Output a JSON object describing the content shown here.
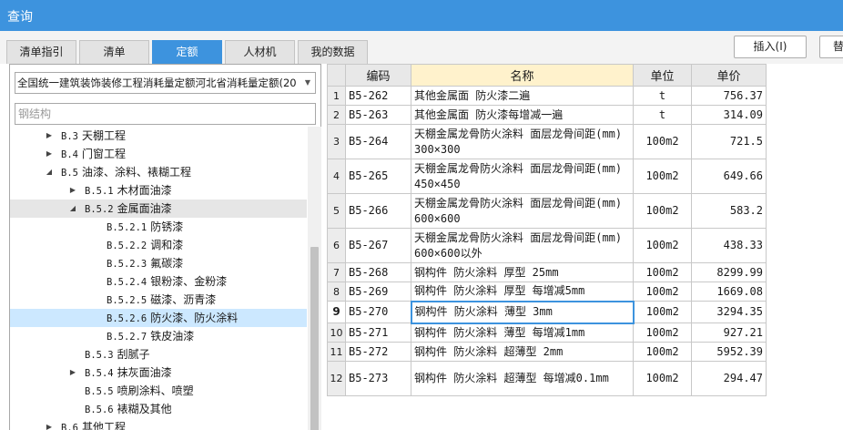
{
  "window": {
    "title": "查询"
  },
  "tabs": [
    "清单指引",
    "清单",
    "定额",
    "人材机",
    "我的数据"
  ],
  "buttons": {
    "insert": "插入(I)",
    "replace": "替"
  },
  "left": {
    "quota_library": "全国统一建筑装饰装修工程消耗量定额河北省消耗量定额(20",
    "search_placeholder": "钢结构",
    "tree": [
      {
        "code": "B.3",
        "label": "天棚工程",
        "level": 1,
        "expander": "collapsed"
      },
      {
        "code": "B.4",
        "label": "门窗工程",
        "level": 1,
        "expander": "collapsed"
      },
      {
        "code": "B.5",
        "label": "油漆、涂料、裱糊工程",
        "level": 1,
        "expander": "expanded"
      },
      {
        "code": "B.5.1",
        "label": "木材面油漆",
        "level": 2,
        "expander": "collapsed"
      },
      {
        "code": "B.5.2",
        "label": "金属面油漆",
        "level": 2,
        "expander": "expanded"
      },
      {
        "code": "B.5.2.1",
        "label": "防锈漆",
        "level": 3,
        "expander": "none"
      },
      {
        "code": "B.5.2.2",
        "label": "调和漆",
        "level": 3,
        "expander": "none"
      },
      {
        "code": "B.5.2.3",
        "label": "氟碳漆",
        "level": 3,
        "expander": "none"
      },
      {
        "code": "B.5.2.4",
        "label": "银粉漆、金粉漆",
        "level": 3,
        "expander": "none"
      },
      {
        "code": "B.5.2.5",
        "label": "磁漆、沥青漆",
        "level": 3,
        "expander": "none"
      },
      {
        "code": "B.5.2.6",
        "label": "防火漆、防火涂料",
        "level": 3,
        "expander": "none"
      },
      {
        "code": "B.5.2.7",
        "label": "铁皮油漆",
        "level": 3,
        "expander": "none"
      },
      {
        "code": "B.5.3",
        "label": "刮腻子",
        "level": 2,
        "expander": "none"
      },
      {
        "code": "B.5.4",
        "label": "抹灰面油漆",
        "level": 2,
        "expander": "collapsed"
      },
      {
        "code": "B.5.5",
        "label": "喷刷涂料、喷塑",
        "level": 2,
        "expander": "none"
      },
      {
        "code": "B.5.6",
        "label": "裱糊及其他",
        "level": 2,
        "expander": "none"
      },
      {
        "code": "B.6",
        "label": "其他工程",
        "level": 1,
        "expander": "collapsed"
      }
    ],
    "selected_index": 10,
    "hover_index": 4
  },
  "grid": {
    "headers": [
      "",
      "编码",
      "名称",
      "单位",
      "单价"
    ],
    "rows": [
      {
        "no": "1",
        "code": "B5-262",
        "name": "其他金属面 防火漆二遍",
        "unit": "t",
        "price": "756.37"
      },
      {
        "no": "2",
        "code": "B5-263",
        "name": "其他金属面 防火漆每增减一遍",
        "unit": "t",
        "price": "314.09"
      },
      {
        "no": "3",
        "code": "B5-264",
        "name": "天棚金属龙骨防火涂料 面层龙骨间距(mm) 300×300",
        "unit": "100m2",
        "price": "721.5"
      },
      {
        "no": "4",
        "code": "B5-265",
        "name": "天棚金属龙骨防火涂料 面层龙骨间距(mm) 450×450",
        "unit": "100m2",
        "price": "649.66"
      },
      {
        "no": "5",
        "code": "B5-266",
        "name": "天棚金属龙骨防火涂料 面层龙骨间距(mm) 600×600",
        "unit": "100m2",
        "price": "583.2"
      },
      {
        "no": "6",
        "code": "B5-267",
        "name": "天棚金属龙骨防火涂料 面层龙骨间距(mm) 600×600以外",
        "unit": "100m2",
        "price": "438.33"
      },
      {
        "no": "7",
        "code": "B5-268",
        "name": "钢构件 防火涂料 厚型 25mm",
        "unit": "100m2",
        "price": "8299.99"
      },
      {
        "no": "8",
        "code": "B5-269",
        "name": "钢构件 防火涂料 厚型 每增减5mm",
        "unit": "100m2",
        "price": "1669.08"
      },
      {
        "no": "9",
        "code": "B5-270",
        "name": "钢构件 防火涂料 薄型 3mm",
        "unit": "100m2",
        "price": "3294.35"
      },
      {
        "no": "10",
        "code": "B5-271",
        "name": "钢构件 防火涂料 薄型 每增减1mm",
        "unit": "100m2",
        "price": "927.21"
      },
      {
        "no": "11",
        "code": "B5-272",
        "name": "钢构件 防火涂料 超薄型 2mm",
        "unit": "100m2",
        "price": "5952.39"
      },
      {
        "no": "12",
        "code": "B5-273",
        "name": "钢构件 防火涂料 超薄型 每增减0.1mm",
        "unit": "100m2",
        "price": "294.47"
      }
    ],
    "current_row": 8
  }
}
